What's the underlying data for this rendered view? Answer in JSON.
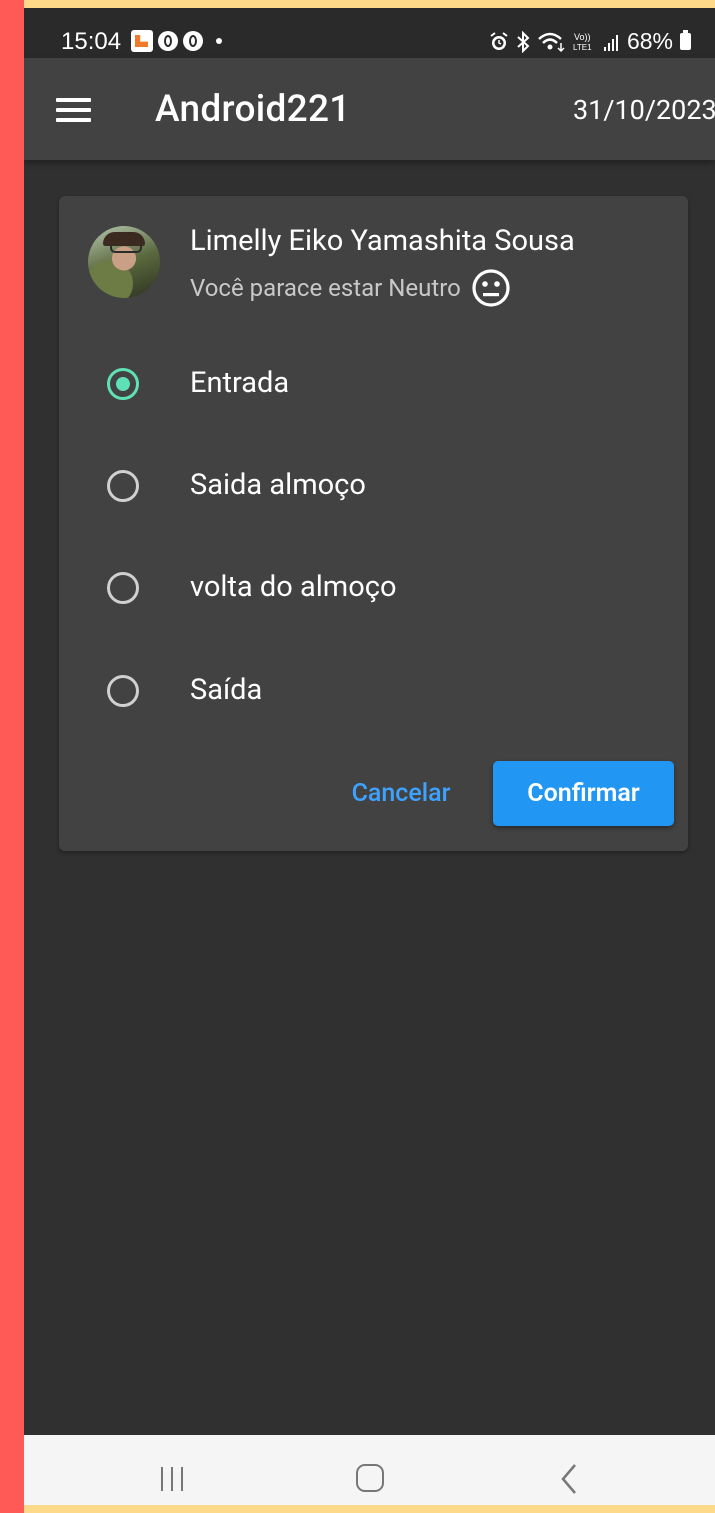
{
  "status_bar": {
    "time": "15:04",
    "battery": "68%",
    "icons": [
      "app-notification-icon",
      "notification-icon",
      "notification-icon",
      "alarm-icon",
      "bluetooth-icon",
      "wifi-icon",
      "volte-icon",
      "signal-icon",
      "battery-icon"
    ]
  },
  "app_bar": {
    "title": "Android221",
    "date": "31/10/2023",
    "menu_icon": "hamburger-menu-icon"
  },
  "card": {
    "user_name": "Limelly Eiko Yamashita Sousa",
    "mood_text": "Você parace estar Neutro",
    "mood_icon": "neutral-face-icon",
    "options": [
      {
        "label": "Entrada",
        "selected": true
      },
      {
        "label": "Saida almoço",
        "selected": false
      },
      {
        "label": "volta do almoço",
        "selected": false
      },
      {
        "label": "Saída",
        "selected": false
      }
    ],
    "cancel_label": "Cancelar",
    "confirm_label": "Confirmar"
  },
  "colors": {
    "accent": "#5fe0b6",
    "primary_button": "#2196f3",
    "text_button": "#3ea2ff",
    "background": "#303030",
    "card": "#424242"
  },
  "nav_bar": {
    "icons": [
      "recent-apps-icon",
      "home-icon",
      "back-icon"
    ]
  }
}
